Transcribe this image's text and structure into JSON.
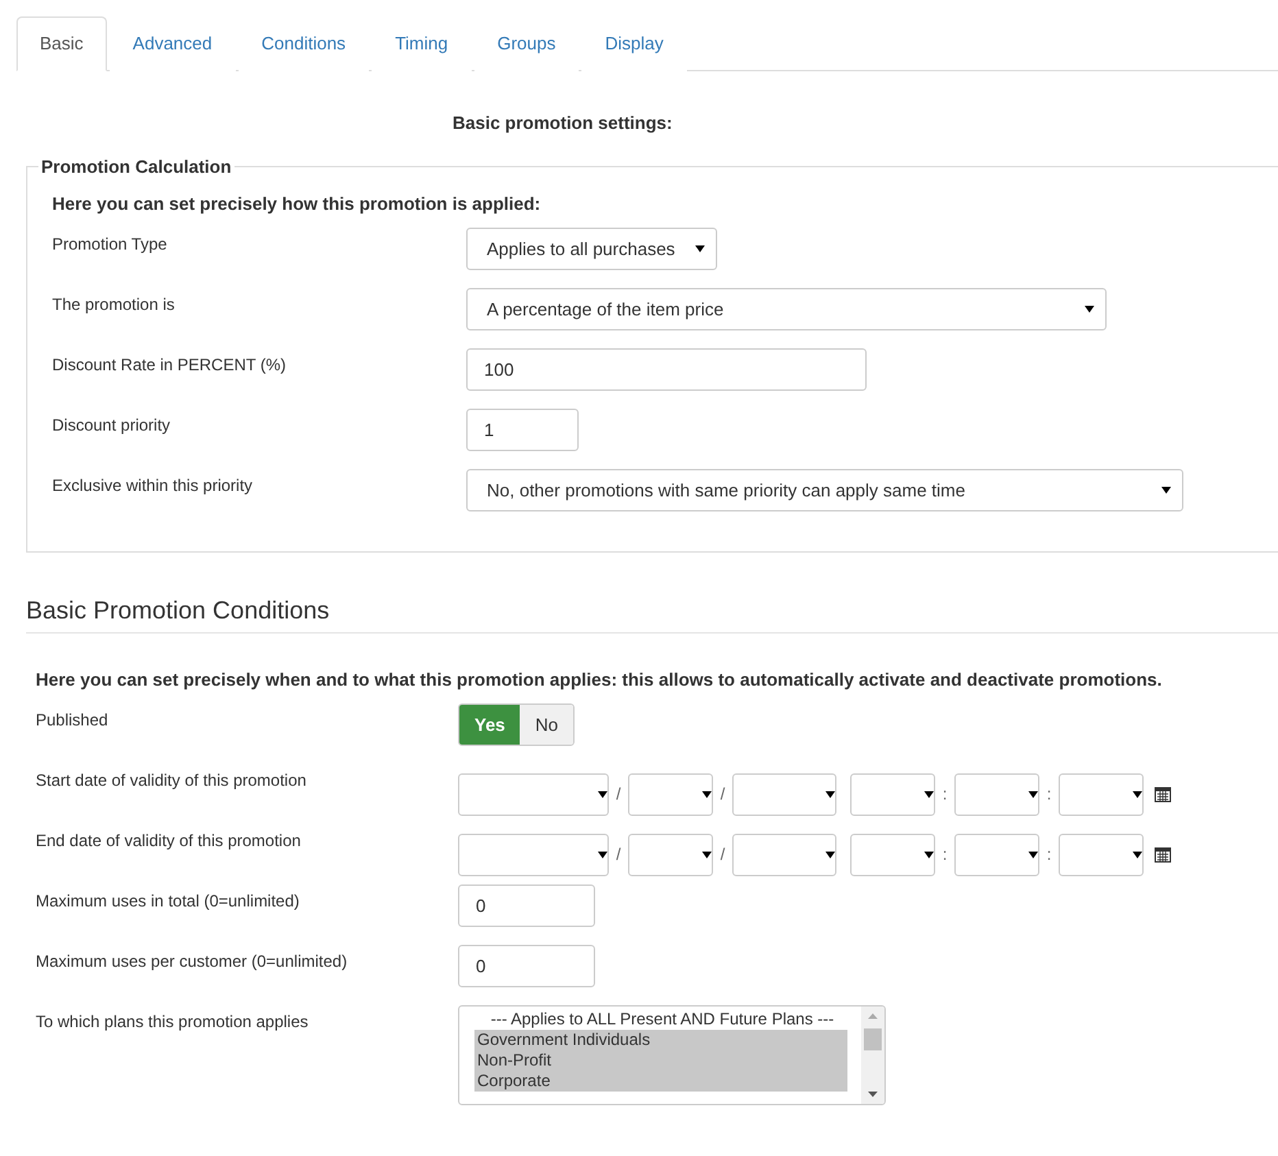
{
  "tabs": [
    {
      "label": "Basic",
      "selected": true
    },
    {
      "label": "Advanced",
      "selected": false
    },
    {
      "label": "Conditions",
      "selected": false
    },
    {
      "label": "Timing",
      "selected": false
    },
    {
      "label": "Groups",
      "selected": false
    },
    {
      "label": "Display",
      "selected": false
    }
  ],
  "page_title": "Basic promotion settings:",
  "calculation": {
    "legend": "Promotion Calculation",
    "intro": "Here you can set precisely how this promotion is applied:",
    "rows": [
      {
        "kind": "select",
        "label": "Promotion Type",
        "value": "Applies to all purchases"
      },
      {
        "kind": "select",
        "label": "The promotion is",
        "value": "A percentage of the item price"
      },
      {
        "kind": "input",
        "label": "Discount Rate in PERCENT (%)",
        "value": "100"
      },
      {
        "kind": "input",
        "label": "Discount priority",
        "value": "1"
      },
      {
        "kind": "select",
        "label": "Exclusive within this priority",
        "value": "No, other promotions with same priority can apply same time"
      }
    ]
  },
  "conditions": {
    "heading": "Basic Promotion Conditions",
    "intro": "Here you can set precisely when and to what this promotion applies: this allows to automatically activate and deactivate promotions.",
    "rows": [
      {
        "kind": "toggle",
        "label": "Published",
        "options": [
          {
            "label": "Yes",
            "selected": true
          },
          {
            "label": "No",
            "selected": false
          }
        ]
      },
      {
        "kind": "date",
        "label": "Start date of validity of this promotion",
        "separators": [
          "/",
          "/",
          ":",
          ":"
        ]
      },
      {
        "kind": "date",
        "label": "End date of validity of this promotion",
        "separators": [
          "/",
          "/",
          ":",
          ":"
        ]
      },
      {
        "kind": "input",
        "label": "Maximum uses in total (0=unlimited)",
        "value": "0"
      },
      {
        "kind": "input",
        "label": "Maximum uses per customer (0=unlimited)",
        "value": "0"
      },
      {
        "kind": "list",
        "label": "To which plans this promotion applies",
        "options": [
          {
            "label": "--- Applies to ALL Present AND Future Plans ---",
            "selected": false
          },
          {
            "label": "Government Individuals",
            "selected": true
          },
          {
            "label": "Non-Profit",
            "selected": true
          },
          {
            "label": "Corporate",
            "selected": true
          }
        ]
      }
    ]
  }
}
